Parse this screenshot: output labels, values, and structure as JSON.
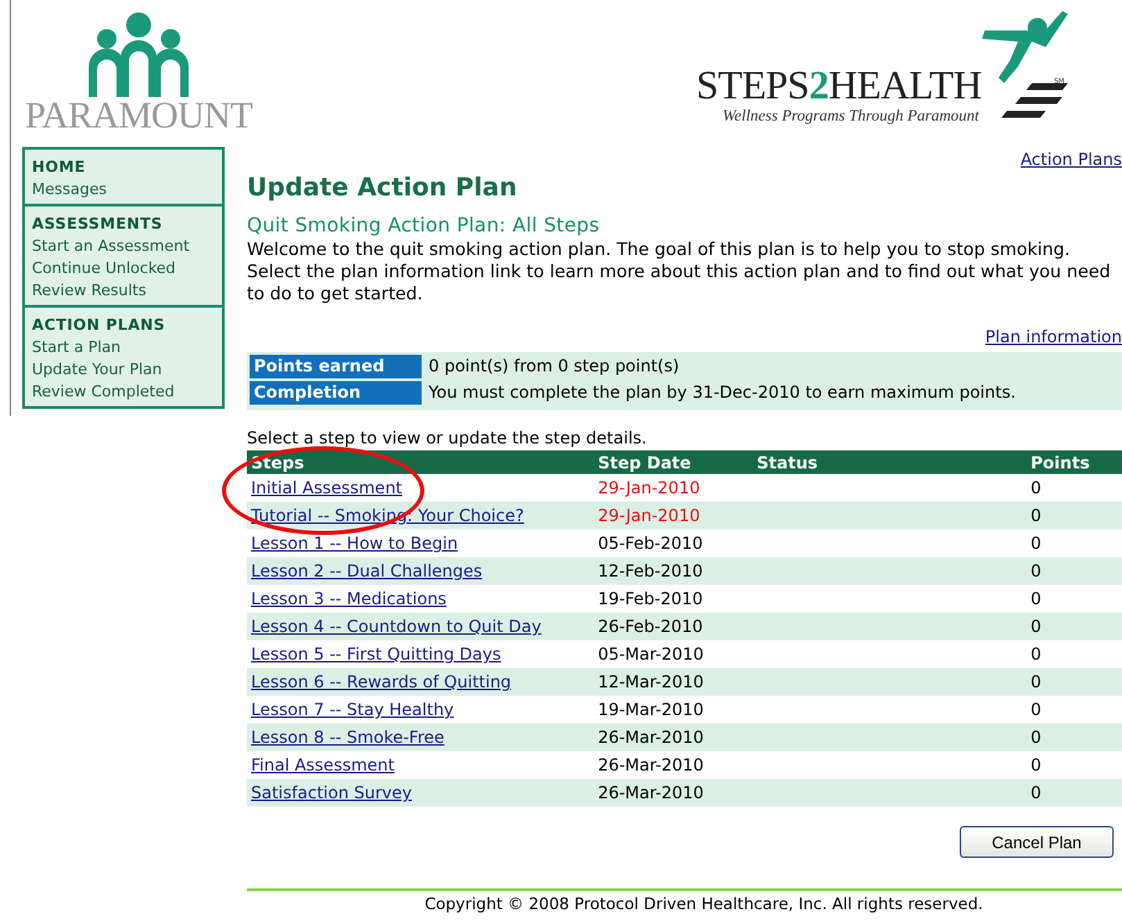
{
  "header": {
    "left_logo": {
      "name": "PARAMOUNT"
    },
    "right_logo": {
      "name_part1": "STEPS",
      "name_part2": "2",
      "name_part3": "HEALTH",
      "mark": "SM",
      "tagline": "Wellness Programs Through Paramount"
    }
  },
  "top_link": "Action Plans",
  "sidebar": [
    {
      "heading": "HOME",
      "items": [
        "Messages"
      ]
    },
    {
      "heading": "ASSESSMENTS",
      "items": [
        "Start an Assessment",
        "Continue Unlocked",
        "Review Results"
      ]
    },
    {
      "heading": "ACTION PLANS",
      "items": [
        "Start a Plan",
        "Update Your Plan",
        "Review Completed"
      ]
    }
  ],
  "title": "Update Action Plan",
  "subtitle": "Quit Smoking Action Plan: All Steps",
  "intro": "Welcome to the quit smoking action plan. The goal of this plan is to help you to stop smoking. Select the plan information link to learn more about this action plan and to find out what you need to do to get started.",
  "info_link": "Plan information",
  "summary": [
    {
      "label": "Points earned",
      "value": "0 point(s) from 0 step point(s)"
    },
    {
      "label": "Completion",
      "value": "You must complete the plan by 31-Dec-2010 to earn maximum points."
    }
  ],
  "instruction": "Select a step to view or update the step details.",
  "table": {
    "columns": [
      "Steps",
      "Step Date",
      "Status",
      "Points"
    ],
    "rows": [
      {
        "step": "Initial Assessment",
        "date": "29-Jan-2010",
        "overdue": true,
        "points": "0"
      },
      {
        "step": "Tutorial -- Smoking: Your Choice?",
        "date": "29-Jan-2010",
        "overdue": true,
        "points": "0"
      },
      {
        "step": "Lesson 1 -- How to Begin",
        "date": "05-Feb-2010",
        "overdue": false,
        "points": "0"
      },
      {
        "step": "Lesson 2 -- Dual Challenges",
        "date": "12-Feb-2010",
        "overdue": false,
        "points": "0"
      },
      {
        "step": "Lesson 3 -- Medications",
        "date": "19-Feb-2010",
        "overdue": false,
        "points": "0"
      },
      {
        "step": "Lesson 4 -- Countdown to Quit Day",
        "date": "26-Feb-2010",
        "overdue": false,
        "points": "0"
      },
      {
        "step": "Lesson 5 -- First Quitting Days",
        "date": "05-Mar-2010",
        "overdue": false,
        "points": "0"
      },
      {
        "step": "Lesson 6 -- Rewards of Quitting",
        "date": "12-Mar-2010",
        "overdue": false,
        "points": "0"
      },
      {
        "step": "Lesson 7 -- Stay Healthy",
        "date": "19-Mar-2010",
        "overdue": false,
        "points": "0"
      },
      {
        "step": "Lesson 8 -- Smoke-Free",
        "date": "26-Mar-2010",
        "overdue": false,
        "points": "0"
      },
      {
        "step": "Final Assessment",
        "date": "26-Mar-2010",
        "overdue": false,
        "points": "0"
      },
      {
        "step": "Satisfaction Survey",
        "date": "26-Mar-2010",
        "overdue": false,
        "points": "0"
      }
    ]
  },
  "annotation": {
    "kind": "ellipse"
  },
  "cancel_button": "Cancel Plan",
  "footer": "Copyright © 2008 Protocol Driven Healthcare, Inc. All rights reserved."
}
